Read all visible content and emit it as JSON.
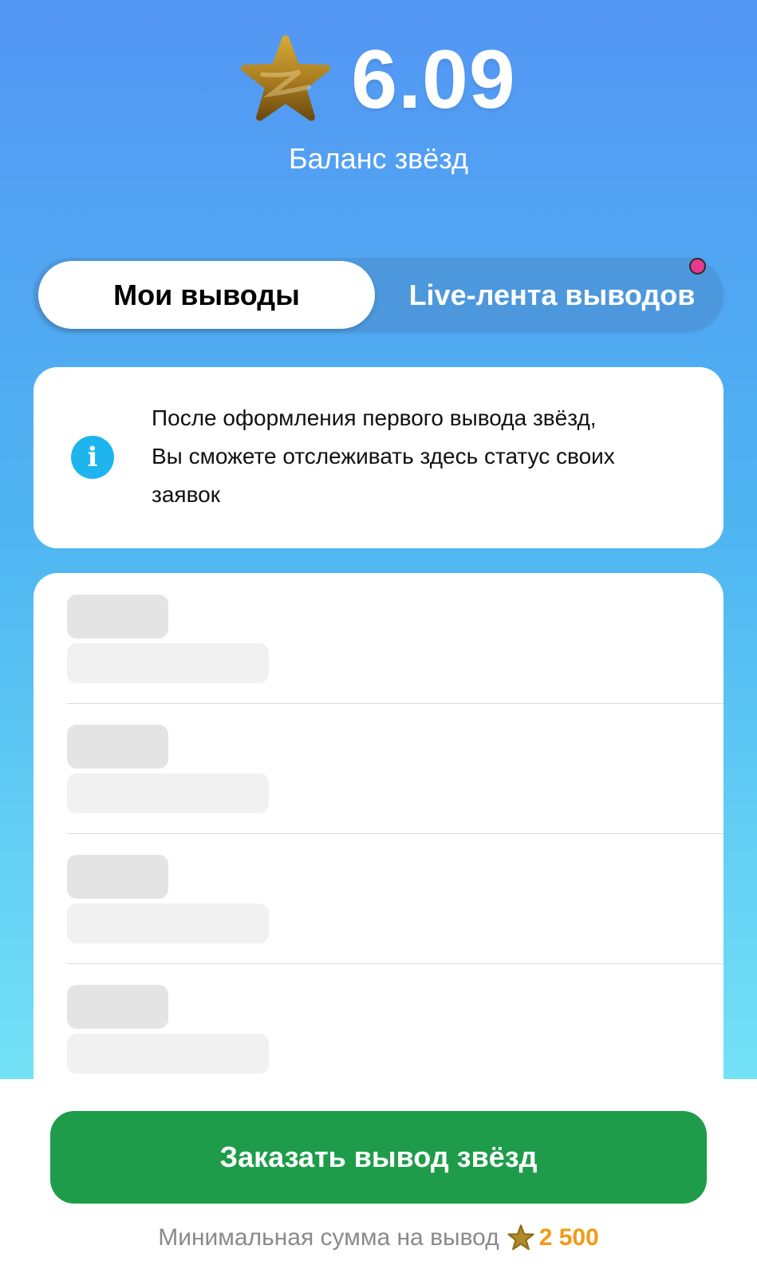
{
  "header": {
    "balance_value": "6.09",
    "balance_label": "Баланс звёзд",
    "star_icon": "star-icon"
  },
  "tabs": [
    {
      "label": "Мои выводы",
      "active": true
    },
    {
      "label": "Live-лента выводов",
      "active": false,
      "has_notification": true
    }
  ],
  "info_card": {
    "icon": "info-icon",
    "icon_glyph": "i",
    "lines": [
      "После оформления первого вывода звёзд,",
      "Вы сможете отслеживать здесь статус своих",
      "заявок"
    ]
  },
  "withdrawals_list": {
    "state": "loading",
    "skeleton_rows": 4
  },
  "footer": {
    "cta_label": "Заказать вывод звёзд",
    "min_label": "Минимальная сумма на вывод",
    "min_value": "2 500"
  },
  "colors": {
    "gradient_top": "#5396f3",
    "gradient_bottom": "#73e2f6",
    "cta_green": "#1e9c4a",
    "accent_orange": "#f39a16",
    "info_blue": "#1eb5ee",
    "notify_pink": "#e63b8c"
  }
}
